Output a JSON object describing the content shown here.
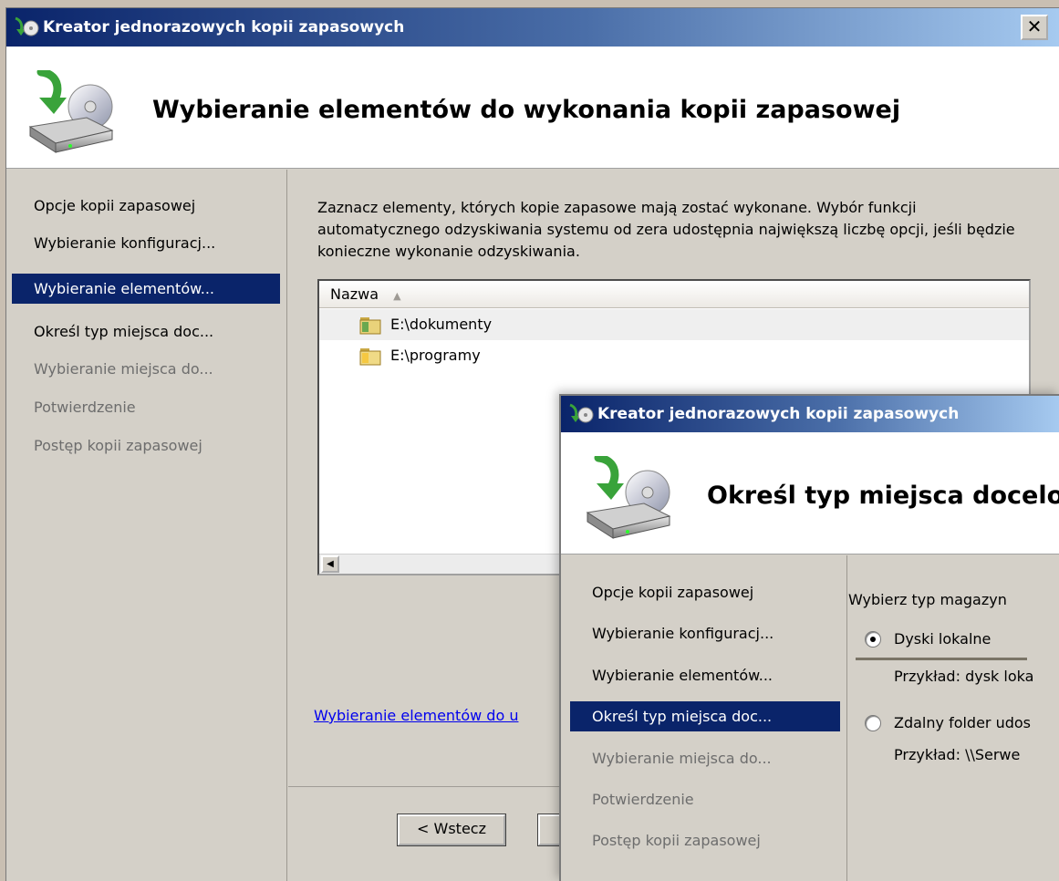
{
  "main_window": {
    "title": "Kreator jednorazowych kopii zapasowych",
    "close_label": "✕",
    "header_title": "Wybieranie elementów do wykonania kopii zapasowej",
    "nav": [
      {
        "label": "Opcje kopii zapasowej",
        "state": "normal"
      },
      {
        "label": "Wybieranie konfiguracj...",
        "state": "normal"
      },
      {
        "label": "Wybieranie elementów...",
        "state": "selected"
      },
      {
        "label": "Określ typ miejsca doc...",
        "state": "normal"
      },
      {
        "label": "Wybieranie miejsca do...",
        "state": "dim"
      },
      {
        "label": "Potwierdzenie",
        "state": "dim"
      },
      {
        "label": "Postęp kopii zapasowej",
        "state": "dim"
      }
    ],
    "description": "Zaznacz elementy, których kopie zapasowe mają zostać wykonane. Wybór funkcji automatycznego odzyskiwania systemu od zera udostępnia największą liczbę opcji, jeśli będzie konieczne wykonanie odzyskiwania.",
    "list_header": "Nazwa",
    "list_items": [
      "E:\\dokumenty",
      "E:\\programy"
    ],
    "link_text": "Wybieranie elementów do u",
    "back_button": "< Wstecz"
  },
  "overlay_window": {
    "title": "Kreator jednorazowych kopii zapasowych",
    "header_title": "Określ typ miejsca docelo",
    "nav": [
      {
        "label": "Opcje kopii zapasowej",
        "state": "normal"
      },
      {
        "label": "Wybieranie konfiguracj...",
        "state": "normal"
      },
      {
        "label": "Wybieranie elementów...",
        "state": "normal"
      },
      {
        "label": "Określ typ miejsca doc...",
        "state": "selected"
      },
      {
        "label": "Wybieranie miejsca do...",
        "state": "dim"
      },
      {
        "label": "Potwierdzenie",
        "state": "dim"
      },
      {
        "label": "Postęp kopii zapasowej",
        "state": "dim"
      }
    ],
    "description": "Wybierz typ magazyn",
    "options": [
      {
        "label": "Dyski lokalne",
        "example": "Przykład: dysk loka",
        "checked": true
      },
      {
        "label": "Zdalny folder udos",
        "example": "Przykład: \\\\Serwe",
        "checked": false
      }
    ]
  },
  "colors": {
    "selection": "#0a246a",
    "link": "#0000ee",
    "dim_text": "#6d6d6d"
  }
}
